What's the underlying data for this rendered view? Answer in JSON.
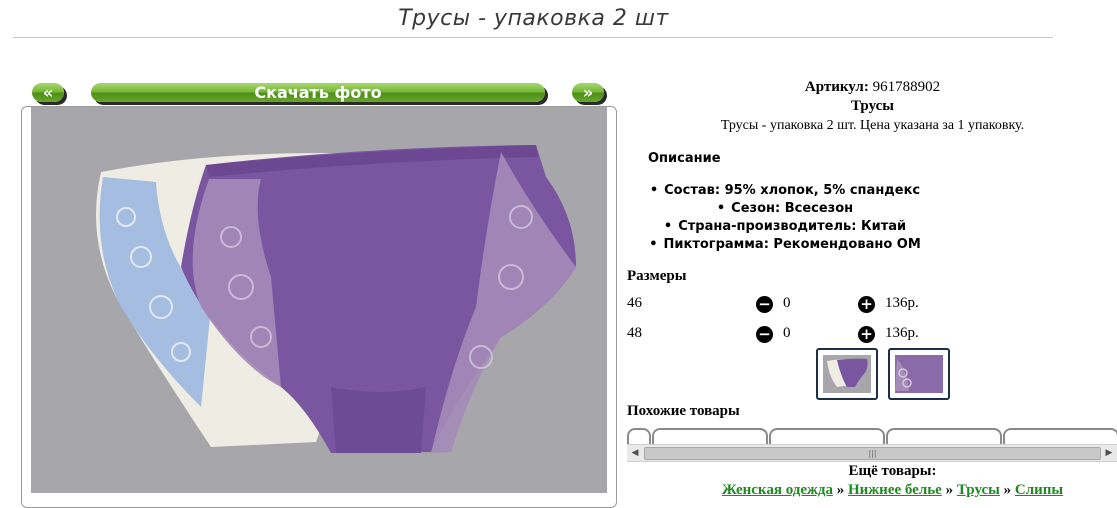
{
  "header": {
    "title": "Трусы - упаковка 2 шт"
  },
  "gallery": {
    "prev_label": "«",
    "download_label": "Скачать фото",
    "next_label": "»"
  },
  "product": {
    "article_label": "Артикул:",
    "article_value": "961788902",
    "name": "Трусы",
    "description": "Трусы - упаковка 2 шт. Цена указана за 1 упаковку."
  },
  "description_section": {
    "heading": "Описание",
    "properties": [
      "Состав: 95% хлопок, 5% спандекс",
      "Сезон: Всесезон",
      "Страна-производитель: Китай",
      "Пиктограмма: Рекомендовано ОМ"
    ]
  },
  "sizes": {
    "heading": "Размеры",
    "rows": [
      {
        "size": "46",
        "qty": "0",
        "price": "136р."
      },
      {
        "size": "48",
        "qty": "0",
        "price": "136р."
      }
    ],
    "minus_icon": "minus-circle-icon",
    "plus_icon": "plus-circle-icon"
  },
  "similar": {
    "heading": "Похожие товары"
  },
  "more": {
    "heading": "Ещё товары:",
    "breadcrumbs": [
      "Женская одежда",
      "Нижнее белье",
      "Трусы",
      "Слипы"
    ],
    "separator": "»"
  },
  "colors": {
    "button_green": "#6aa82c",
    "link_green": "#1d8a1d",
    "photo_bg": "#a6a6ab",
    "purple": "#7a55a0"
  }
}
